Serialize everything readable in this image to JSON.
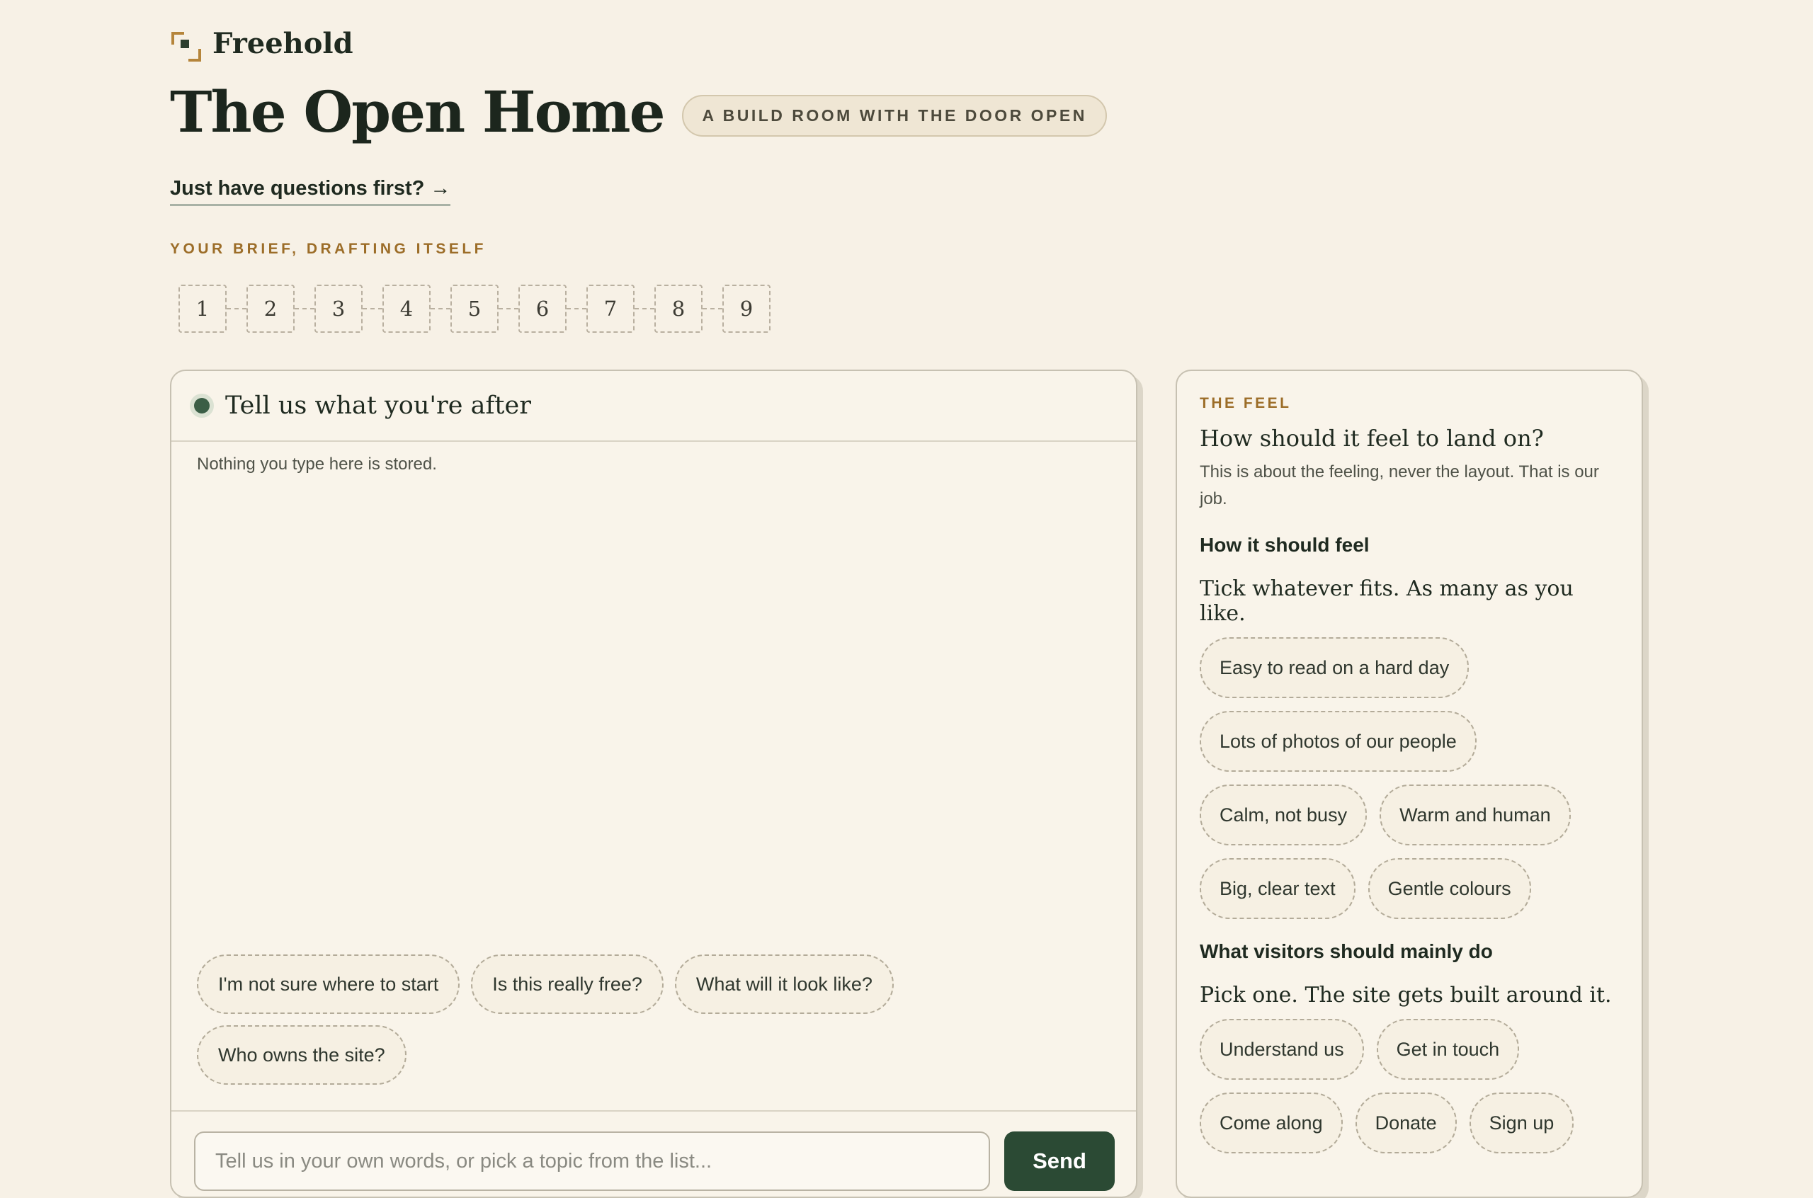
{
  "brand": {
    "name": "Freehold"
  },
  "header": {
    "title": "The Open Home",
    "tag": "A BUILD ROOM WITH THE DOOR OPEN",
    "question_link": "Just have questions first? →",
    "brief_label": "YOUR BRIEF, DRAFTING ITSELF"
  },
  "steps": [
    "1",
    "2",
    "3",
    "4",
    "5",
    "6",
    "7",
    "8",
    "9"
  ],
  "chat": {
    "title": "Tell us what you're after",
    "note": "Nothing you type here is stored.",
    "suggestions": [
      "I'm not sure where to start",
      "Is this really free?",
      "What will it look like?",
      "Who owns the site?"
    ],
    "input_placeholder": "Tell us in your own words, or pick a topic from the list...",
    "send_label": "Send"
  },
  "side": {
    "label": "THE FEEL",
    "heading": "How should it feel to land on?",
    "sub": "This is about the feeling, never the layout. That is our job.",
    "feel": {
      "heading": "How it should feel",
      "sub": "Tick whatever fits. As many as you like.",
      "options": [
        "Easy to read on a hard day",
        "Lots of photos of our people",
        "Calm, not busy",
        "Warm and human",
        "Big, clear text",
        "Gentle colours"
      ]
    },
    "do": {
      "heading": "What visitors should mainly do",
      "sub": "Pick one. The site gets built around it.",
      "options": [
        "Understand us",
        "Get in touch",
        "Come along",
        "Donate",
        "Sign up"
      ]
    }
  },
  "colors": {
    "accent": "#b5853b",
    "primary": "#2b4a34",
    "background": "#f7f1e6"
  }
}
